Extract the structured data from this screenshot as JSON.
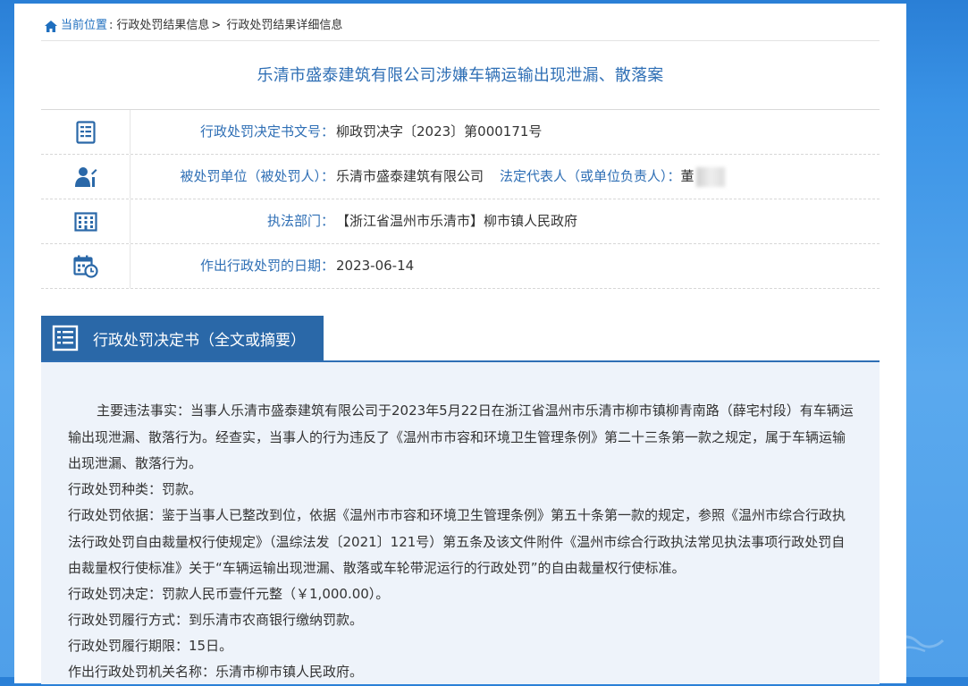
{
  "breadcrumb": {
    "home_label": "当前位置",
    "sep": ":",
    "item1": "行政处罚结果信息",
    "arrow": ">",
    "item2": "行政处罚结果详细信息"
  },
  "page_title": "乐清市盛泰建筑有限公司涉嫌车辆运输出现泄漏、散落案",
  "info_rows": [
    {
      "icon": "document-icon",
      "label": "行政处罚决定书文号：",
      "value": "柳政罚决字〔2023〕第000171号"
    },
    {
      "icon": "person-icon",
      "label": "被处罚单位（被处罚人）：",
      "value": "乐清市盛泰建筑有限公司",
      "extra_label": "法定代表人（或单位负责人）：",
      "extra_value": "董"
    },
    {
      "icon": "building-icon",
      "label": "执法部门：",
      "value": "【浙江省温州市乐清市】柳市镇人民政府"
    },
    {
      "icon": "calendar-clock-icon",
      "label": "作出行政处罚的日期：",
      "value": "2023-06-14"
    }
  ],
  "section": {
    "title": "行政处罚决定书（全文或摘要）"
  },
  "content": {
    "p1": "主要违法事实：当事人乐清市盛泰建筑有限公司于2023年5月22日在浙江省温州市乐清市柳市镇柳青南路（薛宅村段）有车辆运输出现泄漏、散落行为。经查实，当事人的行为违反了《温州市市容和环境卫生管理条例》第二十三条第一款之规定，属于车辆运输出现泄漏、散落行为。",
    "p2": "行政处罚种类：罚款。",
    "p3": "行政处罚依据：鉴于当事人已整改到位，依据《温州市市容和环境卫生管理条例》第五十条第一款的规定，参照《温州市综合行政执法行政处罚自由裁量权行使规定》（温综法发〔2021〕121号）第五条及该文件附件《温州市综合行政执法常见执法事项行政处罚自由裁量权行使标准》关于“车辆运输出现泄漏、散落或车轮带泥运行的行政处罚”的自由裁量权行使标准。",
    "p4": "行政处罚决定：罚款人民币壹仟元整（￥1,000.00）。",
    "p5": "行政处罚履行方式：到乐清市农商银行缴纳罚款。",
    "p6": "行政处罚履行期限：15日。",
    "p7": "作出行政处罚机关名称：乐清市柳市镇人民政府。"
  },
  "colors": {
    "accent_blue": "#2f6fb5",
    "tab_blue": "#2a68a8",
    "content_bg": "#eef3fa"
  }
}
